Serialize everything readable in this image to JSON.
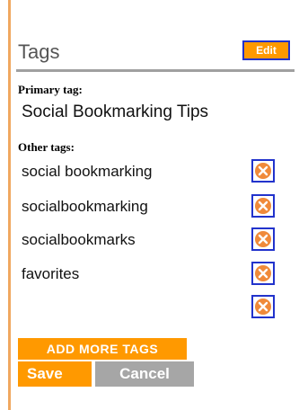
{
  "header": {
    "title": "Tags",
    "edit_label": "Edit"
  },
  "primary": {
    "label": "Primary tag:",
    "value": "Social Bookmarking Tips"
  },
  "other": {
    "label": "Other tags:",
    "tags": [
      {
        "label": "social bookmarking",
        "remove_icon": "remove-circle-icon"
      },
      {
        "label": "socialbookmarking",
        "remove_icon": "remove-circle-icon"
      },
      {
        "label": "socialbookmarks",
        "remove_icon": "remove-circle-icon"
      },
      {
        "label": "favorites",
        "remove_icon": "remove-circle-icon"
      },
      {
        "label": "",
        "remove_icon": "remove-circle-icon"
      }
    ]
  },
  "actions": {
    "add_more_label": "ADD MORE TAGS",
    "save_label": "Save",
    "cancel_label": "Cancel"
  },
  "colors": {
    "accent": "#ff9900",
    "button_border": "#2233cc",
    "cancel_bg": "#a6a6a6",
    "remove_icon": "#f08a3a"
  }
}
